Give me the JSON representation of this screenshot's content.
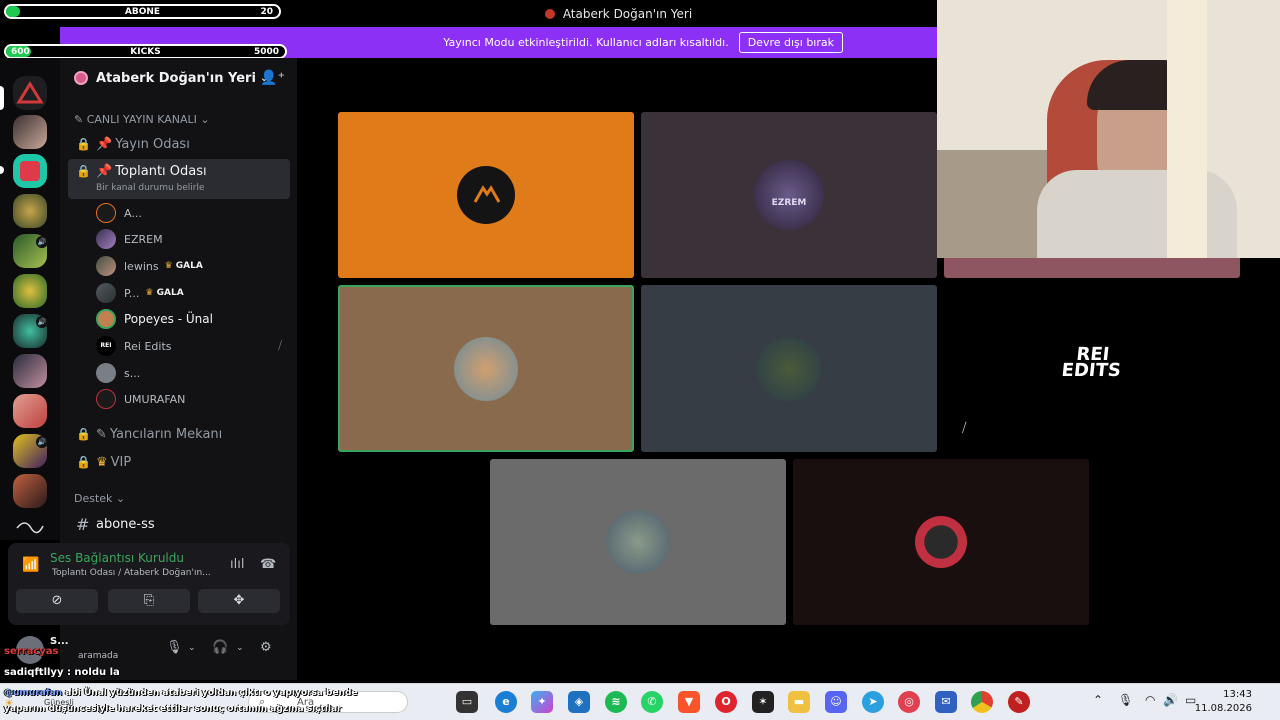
{
  "window": {
    "title": "Ataberk Doğan'ın Yeri"
  },
  "banner": {
    "message": "Yayıncı Modu etkinleştirildi. Kullanıcı adları kısaltıldı.",
    "button": "Devre dışı bırak"
  },
  "overlay": {
    "abone": {
      "label": "ABONE",
      "value": "20",
      "progress": 0.05
    },
    "kicks": {
      "label": "KICKS",
      "start": "600",
      "end": "5000"
    }
  },
  "server": {
    "name": "Ataberk Doğan'ın Yeri",
    "category_live": "CANLI YAYIN KANALI",
    "channels": [
      {
        "name": "Yayın Odası"
      },
      {
        "name": "Toplantı Odası",
        "status": "Bir kanal durumu belirle"
      },
      {
        "name": "Yancıların Mekanı"
      },
      {
        "name": "VIP"
      }
    ],
    "voice_users": [
      {
        "name": "A...",
        "badge": ""
      },
      {
        "name": "EZREM",
        "badge": ""
      },
      {
        "name": "lewins",
        "badge": "GALA"
      },
      {
        "name": "P...",
        "badge": "GALA"
      },
      {
        "name": "Popeyes - Ünal",
        "badge": ""
      },
      {
        "name": "Rei Edits",
        "badge": ""
      },
      {
        "name": "s...",
        "badge": ""
      },
      {
        "name": "UMURAFAN",
        "badge": ""
      }
    ],
    "category_support": "Destek",
    "text_channel": "abone-ss"
  },
  "voice_panel": {
    "status": "Ses Bağlantısı Kuruldu",
    "location": "Toplantı Odası / Ataberk Doğan'ın..."
  },
  "user_area": {
    "name": "S...",
    "status": "aramada"
  },
  "tiles": {
    "ezrem_label": "EZREM",
    "rei_line1": "REI",
    "rei_line2": "EDITS"
  },
  "chat": {
    "line1_user": "sadiqftllyy",
    "line1_msg": ": noldu la",
    "line2_user": "serracyas",
    "line3": "abi Ünal yüzünden ataberi yoldan çıktı o yapıyorsa bende",
    "line3_mention": "@umurafan",
    "line4": "yaparım düşüncesiyle hareket ettiler sonuç ortamın ağzına sıçtılar"
  },
  "taskbar": {
    "search": "Ara",
    "weather": "Güneşli",
    "time": "13:43",
    "date": "11.08.2026"
  }
}
